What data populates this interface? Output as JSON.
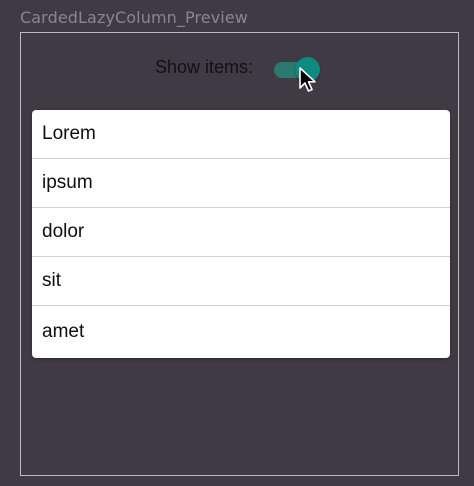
{
  "preview": {
    "title": "CardedLazyColumn_Preview"
  },
  "toggle": {
    "label": "Show items:",
    "checked": true,
    "track_color": "#2b7a72",
    "thumb_color": "#0f8a7e"
  },
  "list": {
    "items": [
      "Lorem",
      "ipsum",
      "dolor",
      "sit",
      "amet"
    ]
  },
  "colors": {
    "background": "#403a44",
    "frame_border": "#bdb9c1",
    "card": "#ffffff"
  }
}
